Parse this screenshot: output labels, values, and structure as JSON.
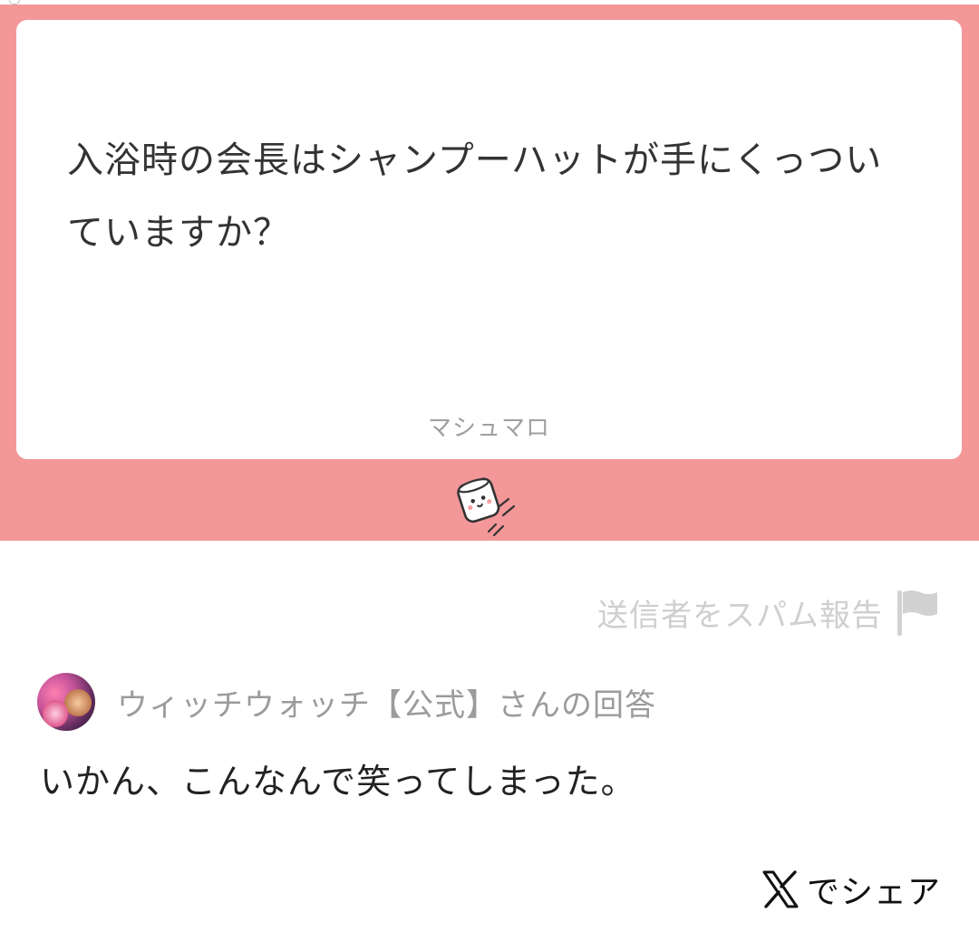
{
  "question": {
    "text": "入浴時の会長はシャンプーハットが手にくっついていますか？"
  },
  "brand": {
    "name": "マシュマロ"
  },
  "report": {
    "label": "送信者をスパム報告",
    "icon": "flag-icon"
  },
  "answerer": {
    "label": "ウィッチウォッチ【公式】さんの回答"
  },
  "answer": {
    "text": "いかん、こんなんで笑ってしまった。"
  },
  "share": {
    "label": "でシェア",
    "icon": "x-logo-icon"
  },
  "colors": {
    "banner": "#f39799",
    "card": "#ffffff",
    "muted_text": "#9b9b9b",
    "report_text": "#cfcfcf"
  }
}
